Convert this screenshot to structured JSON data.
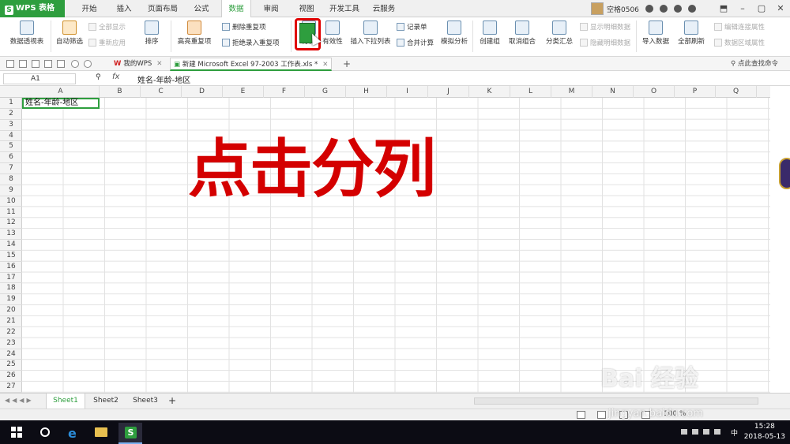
{
  "app": {
    "logo": "WPS 表格",
    "logo_letter": "S"
  },
  "menu": [
    "开始",
    "插入",
    "页面布局",
    "公式",
    "数据",
    "审阅",
    "视图",
    "开发工具",
    "云服务"
  ],
  "active_menu": "数据",
  "user": {
    "name": "空格0506"
  },
  "ribbon": {
    "pivot": "数据透视表",
    "autofilter": "自动筛选",
    "show_all": "全部显示",
    "reapply": "重新应用",
    "sort": "排序",
    "highlight_dup": "高亮重复项",
    "remove_dup": "删除重复项",
    "reject_dup": "拒绝录入重复项",
    "split": "分列",
    "validity": "有效性",
    "dropdown": "插入下拉列表",
    "record": "记录单",
    "merge_calc": "合并计算",
    "simulate": "模拟分析",
    "create_group": "创建组",
    "ungroup": "取消组合",
    "subtotal": "分类汇总",
    "show_detail": "显示明细数据",
    "hide_detail": "隐藏明细数据",
    "import": "导入数据",
    "refresh_all": "全部刷新",
    "edit_link": "编辑连接属性",
    "range_prop": "数据区域属性"
  },
  "qbar": {
    "tab_mywps": "我的WPS",
    "tab_doc": "新建 Microsoft Excel 97-2003 工作表.xls *",
    "search": "点此查找命令"
  },
  "formula": {
    "cell_ref": "A1",
    "fx": "fx",
    "value": "姓名-年龄-地区"
  },
  "columns": [
    "A",
    "B",
    "C",
    "D",
    "E",
    "F",
    "G",
    "H",
    "I",
    "J",
    "K",
    "L",
    "M",
    "N",
    "O",
    "P",
    "Q"
  ],
  "rows": [
    "1",
    "2",
    "3",
    "4",
    "5",
    "6",
    "7",
    "8",
    "9",
    "10",
    "11",
    "12",
    "13",
    "14",
    "15",
    "16",
    "17",
    "18",
    "19",
    "20",
    "21",
    "22",
    "23",
    "24",
    "25",
    "26",
    "27"
  ],
  "cell_a1": "姓名-年龄-地区",
  "overlay_text": "点击分列",
  "sheets": [
    "Sheet1",
    "Sheet2",
    "Sheet3"
  ],
  "active_sheet": "Sheet1",
  "add_sheet": "+",
  "status": {
    "zoom": "100 %"
  },
  "taskbar": {
    "wps_letter": "S",
    "ime": "中",
    "time": "15:28",
    "date": "2018-05-13"
  },
  "watermark": {
    "brand": "Bai 经验",
    "url": "jingyan.baidu.com"
  },
  "colors": {
    "accent": "#2e9e3e",
    "overlay": "#d40000",
    "highlight": "#e00000"
  }
}
